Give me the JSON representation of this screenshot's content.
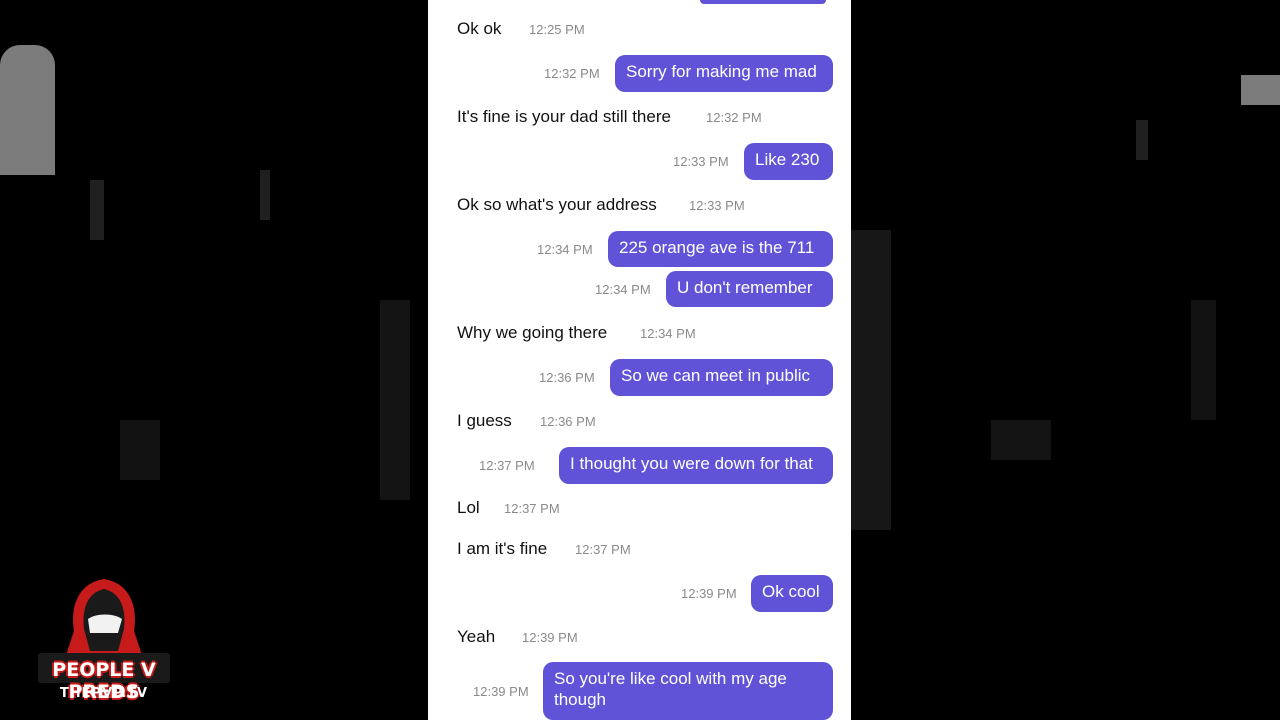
{
  "messages": [
    {
      "side": "received",
      "text": "Ok ok",
      "time": "12:25 PM"
    },
    {
      "side": "sent",
      "text": "Sorry for making me mad",
      "time": "12:32 PM"
    },
    {
      "side": "received",
      "text": "It's fine is your dad still there",
      "time": "12:32 PM"
    },
    {
      "side": "sent",
      "text": "Like 230",
      "time": "12:33 PM"
    },
    {
      "side": "received",
      "text": "Ok so what's your address",
      "time": "12:33 PM"
    },
    {
      "side": "sent",
      "text": "225 orange ave is the 711",
      "time": "12:34 PM"
    },
    {
      "side": "sent",
      "text": "U don't remember",
      "time": "12:34 PM"
    },
    {
      "side": "received",
      "text": "Why we going there",
      "time": "12:34 PM"
    },
    {
      "side": "sent",
      "text": "So we can meet in public",
      "time": "12:36 PM"
    },
    {
      "side": "received",
      "text": "I guess",
      "time": "12:36 PM"
    },
    {
      "side": "sent",
      "text": "I thought you were down for that",
      "time": "12:37 PM"
    },
    {
      "side": "received",
      "text": "Lol",
      "time": "12:37 PM"
    },
    {
      "side": "received",
      "text": "I am it's fine",
      "time": "12:37 PM"
    },
    {
      "side": "sent",
      "text": "Ok cool",
      "time": "12:39 PM"
    },
    {
      "side": "received",
      "text": "Yeah",
      "time": "12:39 PM"
    },
    {
      "side": "sent",
      "text": "So you're like cool with my age though",
      "time": "12:39 PM"
    }
  ],
  "logo": {
    "title": "PEOPLE V PREDS",
    "subtitle": "THEPVP.TV",
    "icon": "hooded-figure-icon"
  },
  "colors": {
    "sent_bubble": "#6053d8",
    "background": "#000000",
    "panel": "#ffffff",
    "logo_red": "#c71a1a"
  }
}
